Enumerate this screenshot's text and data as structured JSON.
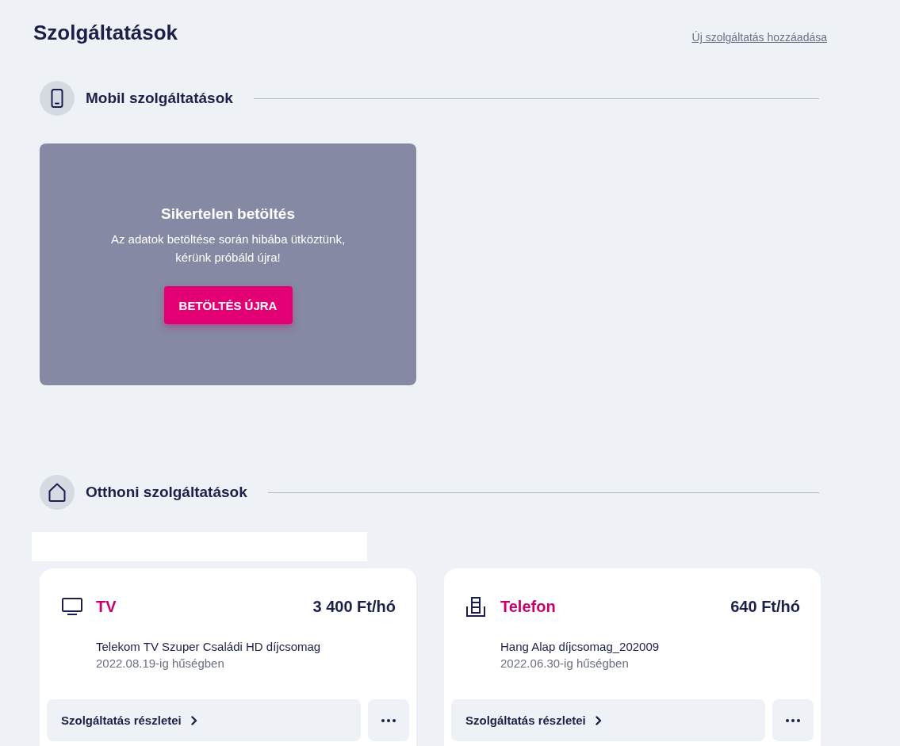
{
  "page": {
    "title": "Szolgáltatások",
    "add_link": "Új szolgáltatás hozzáadása"
  },
  "sections": [
    {
      "kind": "mobile",
      "title": "Mobil szolgáltatások",
      "error": {
        "title": "Sikertelen betöltés",
        "message": "Az adatok betöltése során hibába ütköztünk, kérünk próbáld újra!",
        "button": "BETÖLTÉS ÚJRA"
      }
    },
    {
      "kind": "home",
      "title": "Otthoni szolgáltatások",
      "services": [
        {
          "kind": "tv",
          "name": "TV",
          "price": "3 400 Ft/hó",
          "plan": "Telekom TV Szuper Családi HD díjcsomag",
          "commitment": "2022.08.19-ig hűségben",
          "details_button": "Szolgáltatás részletei"
        },
        {
          "kind": "phone",
          "name": "Telefon",
          "price": "640 Ft/hó",
          "plan": "Hang Alap díjcsomag_202009",
          "commitment": "2022.06.30-ig hűségben",
          "details_button": "Szolgáltatás részletei"
        }
      ]
    }
  ]
}
